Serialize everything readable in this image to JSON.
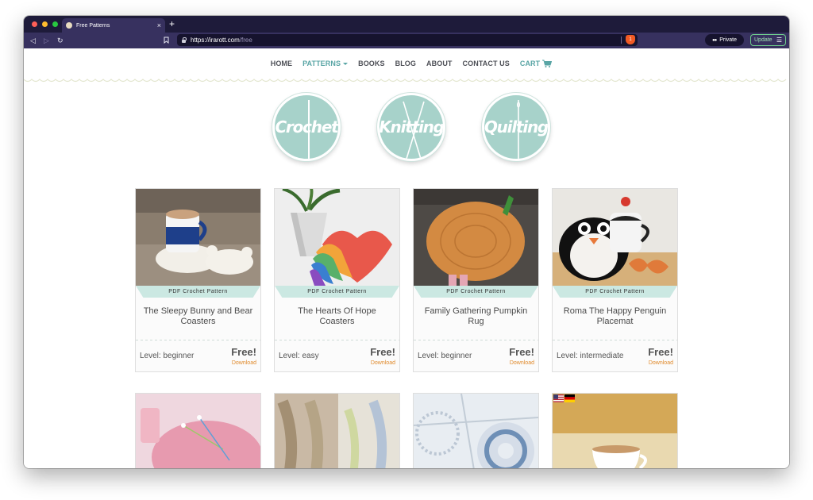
{
  "browser": {
    "tab_title": "Free Patterns",
    "tab_close": "×",
    "new_tab": "+",
    "url_domain": "https://irarott.com",
    "url_path": "/free",
    "shield_count": "1",
    "private_label": "Private",
    "update_label": "Update"
  },
  "nav": {
    "home": "HOME",
    "patterns": "PATTERNS",
    "books": "BOOKS",
    "blog": "BLOG",
    "about": "ABOUT",
    "contact": "CONTACT US",
    "cart": "CART"
  },
  "categories": [
    {
      "label": "Crochet"
    },
    {
      "label": "Knitting"
    },
    {
      "label": "Quilting"
    }
  ],
  "cards": [
    {
      "badge": "PDF Crochet Pattern",
      "title": "The Sleepy Bunny and Bear Coasters",
      "level": "Level: beginner",
      "price": "Free!",
      "action": "Download"
    },
    {
      "badge": "PDF Crochet Pattern",
      "title": "The Hearts Of Hope Coasters",
      "level": "Level: easy",
      "price": "Free!",
      "action": "Download"
    },
    {
      "badge": "PDF Crochet Pattern",
      "title": "Family Gathering Pumpkin Rug",
      "level": "Level: beginner",
      "price": "Free!",
      "action": "Download"
    },
    {
      "badge": "PDF Crochet Pattern",
      "title": "Roma The Happy Penguin Placemat",
      "level": "Level: intermediate",
      "price": "Free!",
      "action": "Download"
    }
  ],
  "colors": {
    "accent_teal": "#59a5a5",
    "circle_teal": "#a7d2ca",
    "ribbon_mint": "#cbe8e2",
    "download_orange": "#e08a2c",
    "browser_dark": "#1e1b3a"
  }
}
